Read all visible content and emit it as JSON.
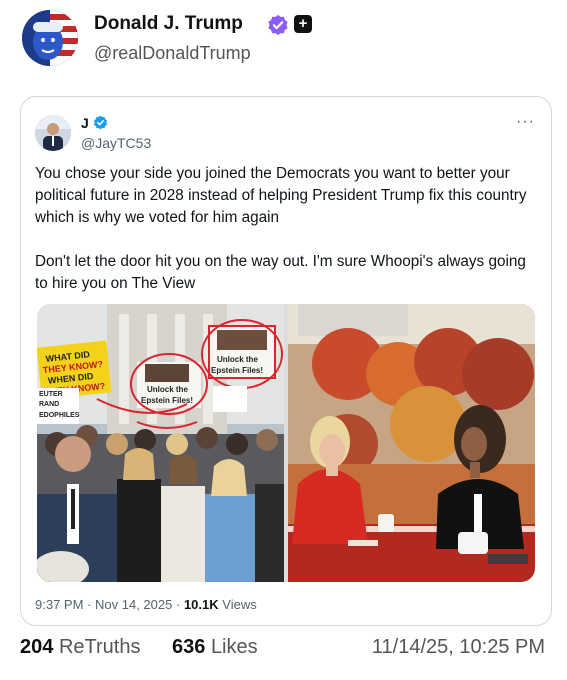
{
  "post": {
    "author_name": "Donald J. Trump",
    "author_handle": "@realDonaldTrump",
    "plus_symbol": "+",
    "retruths_count": "204",
    "retruths_label": "ReTruths",
    "likes_count": "636",
    "likes_label": "Likes",
    "datetime": "11/14/25, 10:25 PM"
  },
  "quoted_tweet": {
    "author_name": "J",
    "author_handle": "@JayTC53",
    "more_label": "···",
    "text": "You chose your side you joined the Democrats you want to better your political future in 2028 instead of helping President Trump fix this country which is why we voted for him again\n\nDon't let the door hit you on the way out. I'm sure Whoopi's always going to hire you on The View",
    "time": "9:37 PM",
    "date": "Nov 14, 2025",
    "views_count": "10.1K",
    "views_label": "Views",
    "sep": "·"
  },
  "media": {
    "left_signs": {
      "sign1": [
        "WHAT DID",
        "THEY KNOW?",
        "WHEN DID",
        "THEY KNOW?"
      ],
      "sign2": [
        "Unlock the",
        "Epstein Files!"
      ],
      "sign3": [
        "Unlock the",
        "Epstein Files!"
      ],
      "sign4": [
        "EUTER",
        "RAND",
        "EDOPHILES"
      ]
    }
  },
  "colors": {
    "verified_blue": "#1d9bf0",
    "verified_purple": "#8b5cf6",
    "accent_red": "#d8262f"
  },
  "icons": {
    "verified": "verified-badge-icon",
    "plus": "plus-square-icon",
    "more": "more-dots-icon"
  }
}
